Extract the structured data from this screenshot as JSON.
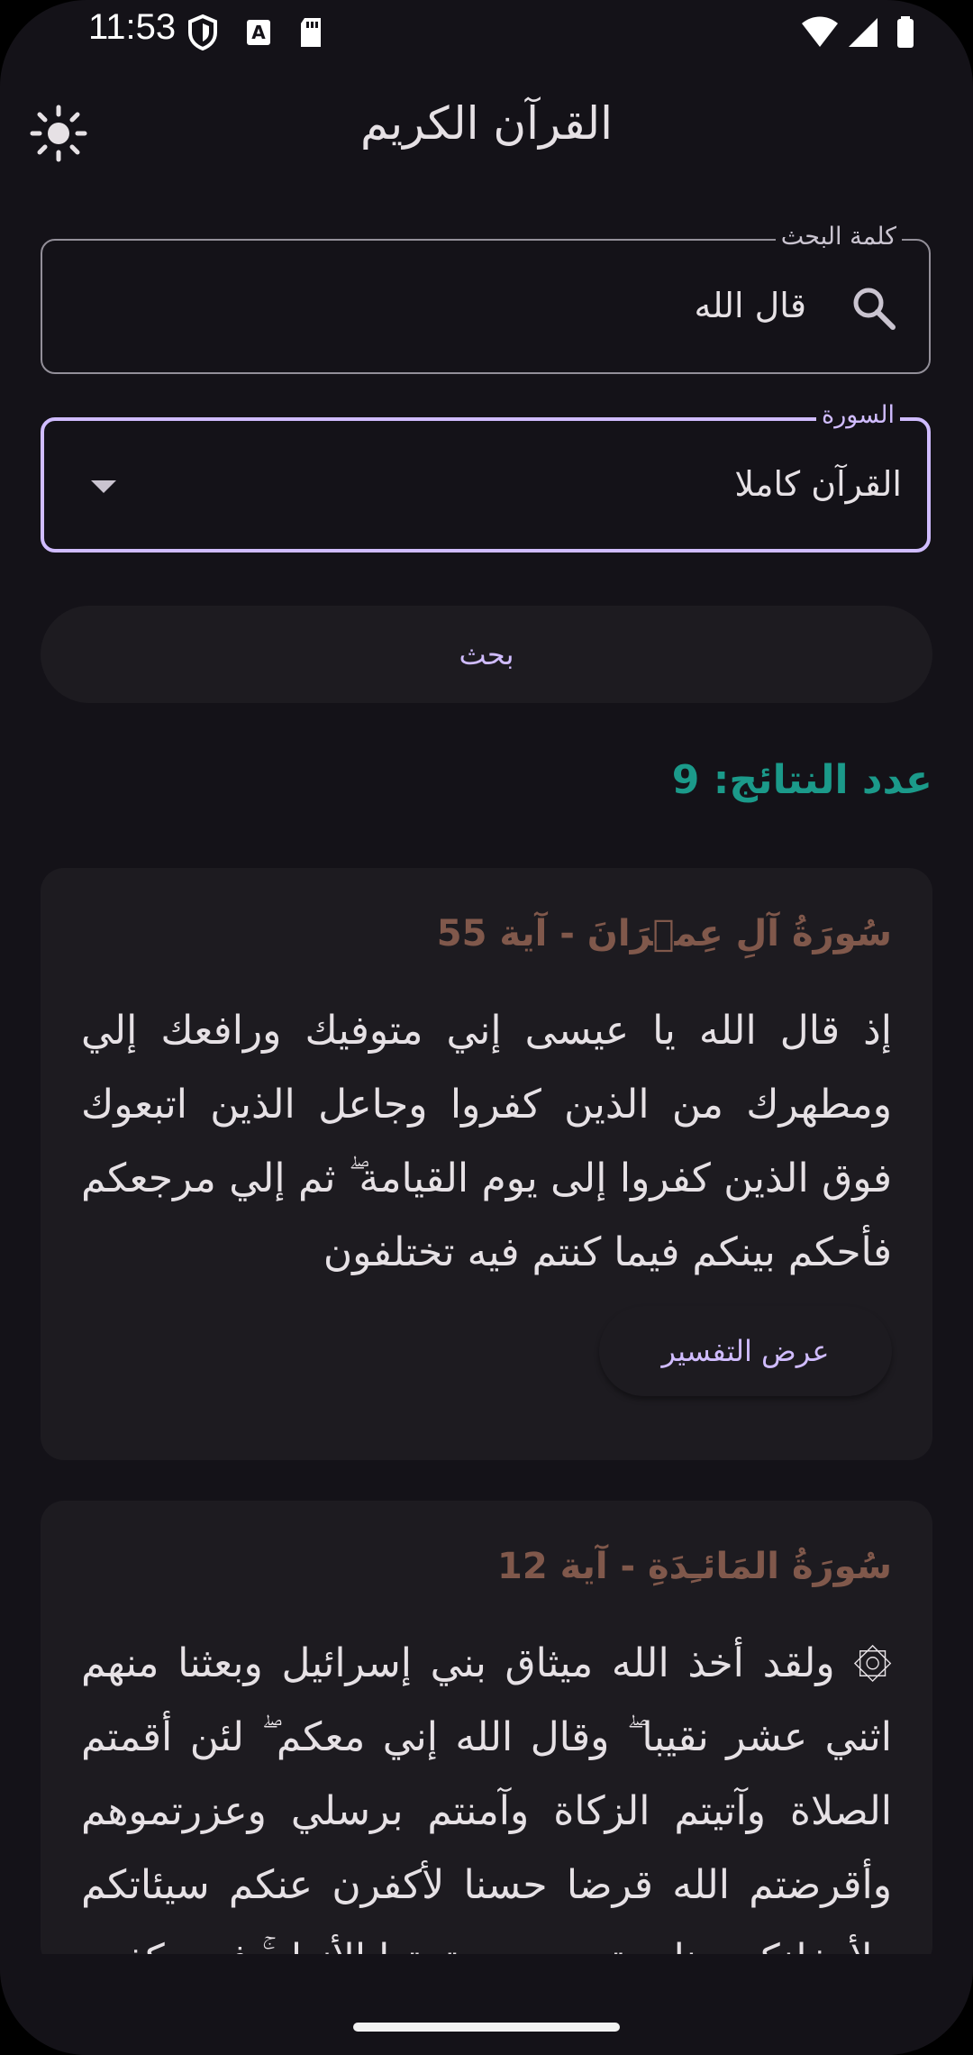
{
  "status_bar": {
    "time": "11:53",
    "icons_left": [
      "shield-icon",
      "text-a-icon",
      "sd-card-icon"
    ],
    "icons_right": [
      "wifi-icon",
      "signal-icon",
      "battery-icon"
    ]
  },
  "app_bar": {
    "title": "القرآن الكريم",
    "theme_icon": "sun-icon"
  },
  "search": {
    "label": "كلمة البحث",
    "value": "قال الله",
    "icon": "search-icon"
  },
  "surah_select": {
    "label": "السورة",
    "selected": "القرآن كاملا",
    "icon": "dropdown-arrow-icon"
  },
  "search_button": "بحث",
  "results_count": "عدد النتائج: 9",
  "results": [
    {
      "title": "سُورَةُ آلِ عِمۡرَانَ - آية 55",
      "text": "إذ قال الله يا عيسى إني متوفيك ورافعك إلي ومطهرك من الذين كفروا وجاعل الذين اتبعوك فوق الذين كفروا إلى يوم القيامة ۖ ثم إلي مرجعكم فأحكم بينكم فيما كنتم فيه تختلفون",
      "button": "عرض التفسير"
    },
    {
      "title": "سُورَةُ المَائـِدَةِ - آية 12",
      "text": "۞ ولقد أخذ الله ميثاق بني إسرائيل وبعثنا منهم اثني عشر نقيبا ۖ وقال الله إني معكم ۖ لئن أقمتم الصلاة وآتيتم الزكاة وآمنتم برسلي وعزرتموهم وأقرضتم الله قرضا حسنا لأكفرن عنكم سيئاتكم ولأدخلنكم جنات تجري من تحتها الأنهار ۚ فمن كفر",
      "button": "عرض التفسير"
    }
  ],
  "colors": {
    "background": "#141218",
    "accent": "#d0bcff",
    "card": "#1d1b20",
    "results_count": "#1b9a8a",
    "card_title": "#80584b"
  }
}
